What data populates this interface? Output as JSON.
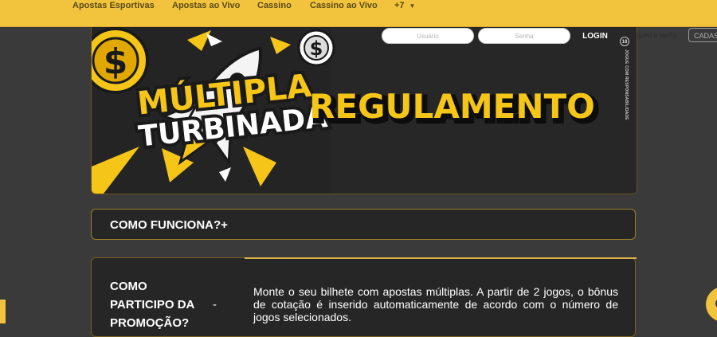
{
  "nav": {
    "items": [
      {
        "label": "Apostas Esportivas"
      },
      {
        "label": "Apostas ao Vivo"
      },
      {
        "label": "Cassino"
      },
      {
        "label": "Cassino ao Vivo"
      },
      {
        "label": "+7"
      }
    ]
  },
  "auth": {
    "user_placeholder": "Usuário",
    "password_placeholder": "Senha",
    "login_label": "LOGIN",
    "forgot_label": "Esqueci a senha",
    "register_label": "CADASTRO"
  },
  "banner": {
    "line1": "MÚLTIPLA",
    "line2": "TURBINADA",
    "headline": "REGULAMENTO",
    "coin_symbol": "$",
    "age_badge": "18",
    "responsible_text": "JOGUE COM RESPONSABILIDADE"
  },
  "faq": {
    "title": "COMO FUNCIONA?+"
  },
  "section": {
    "question": "COMO PARTICIPO DA PROMOÇÃO?",
    "dash": "-",
    "answer": "Monte o seu bilhete com apostas múltiplas. A partir de 2 jogos, o bônus de cotação é inserido automaticamente de acordo com o número de jogos selecionados."
  },
  "colors": {
    "brand_yellow": "#f2c43d",
    "page_bg": "#3a3a3a",
    "card_bg": "#262626",
    "border_gold": "#9c7d2a"
  },
  "icons": [
    "chevron-down-icon",
    "coin-icon",
    "rocket-icon",
    "chat-icon"
  ]
}
